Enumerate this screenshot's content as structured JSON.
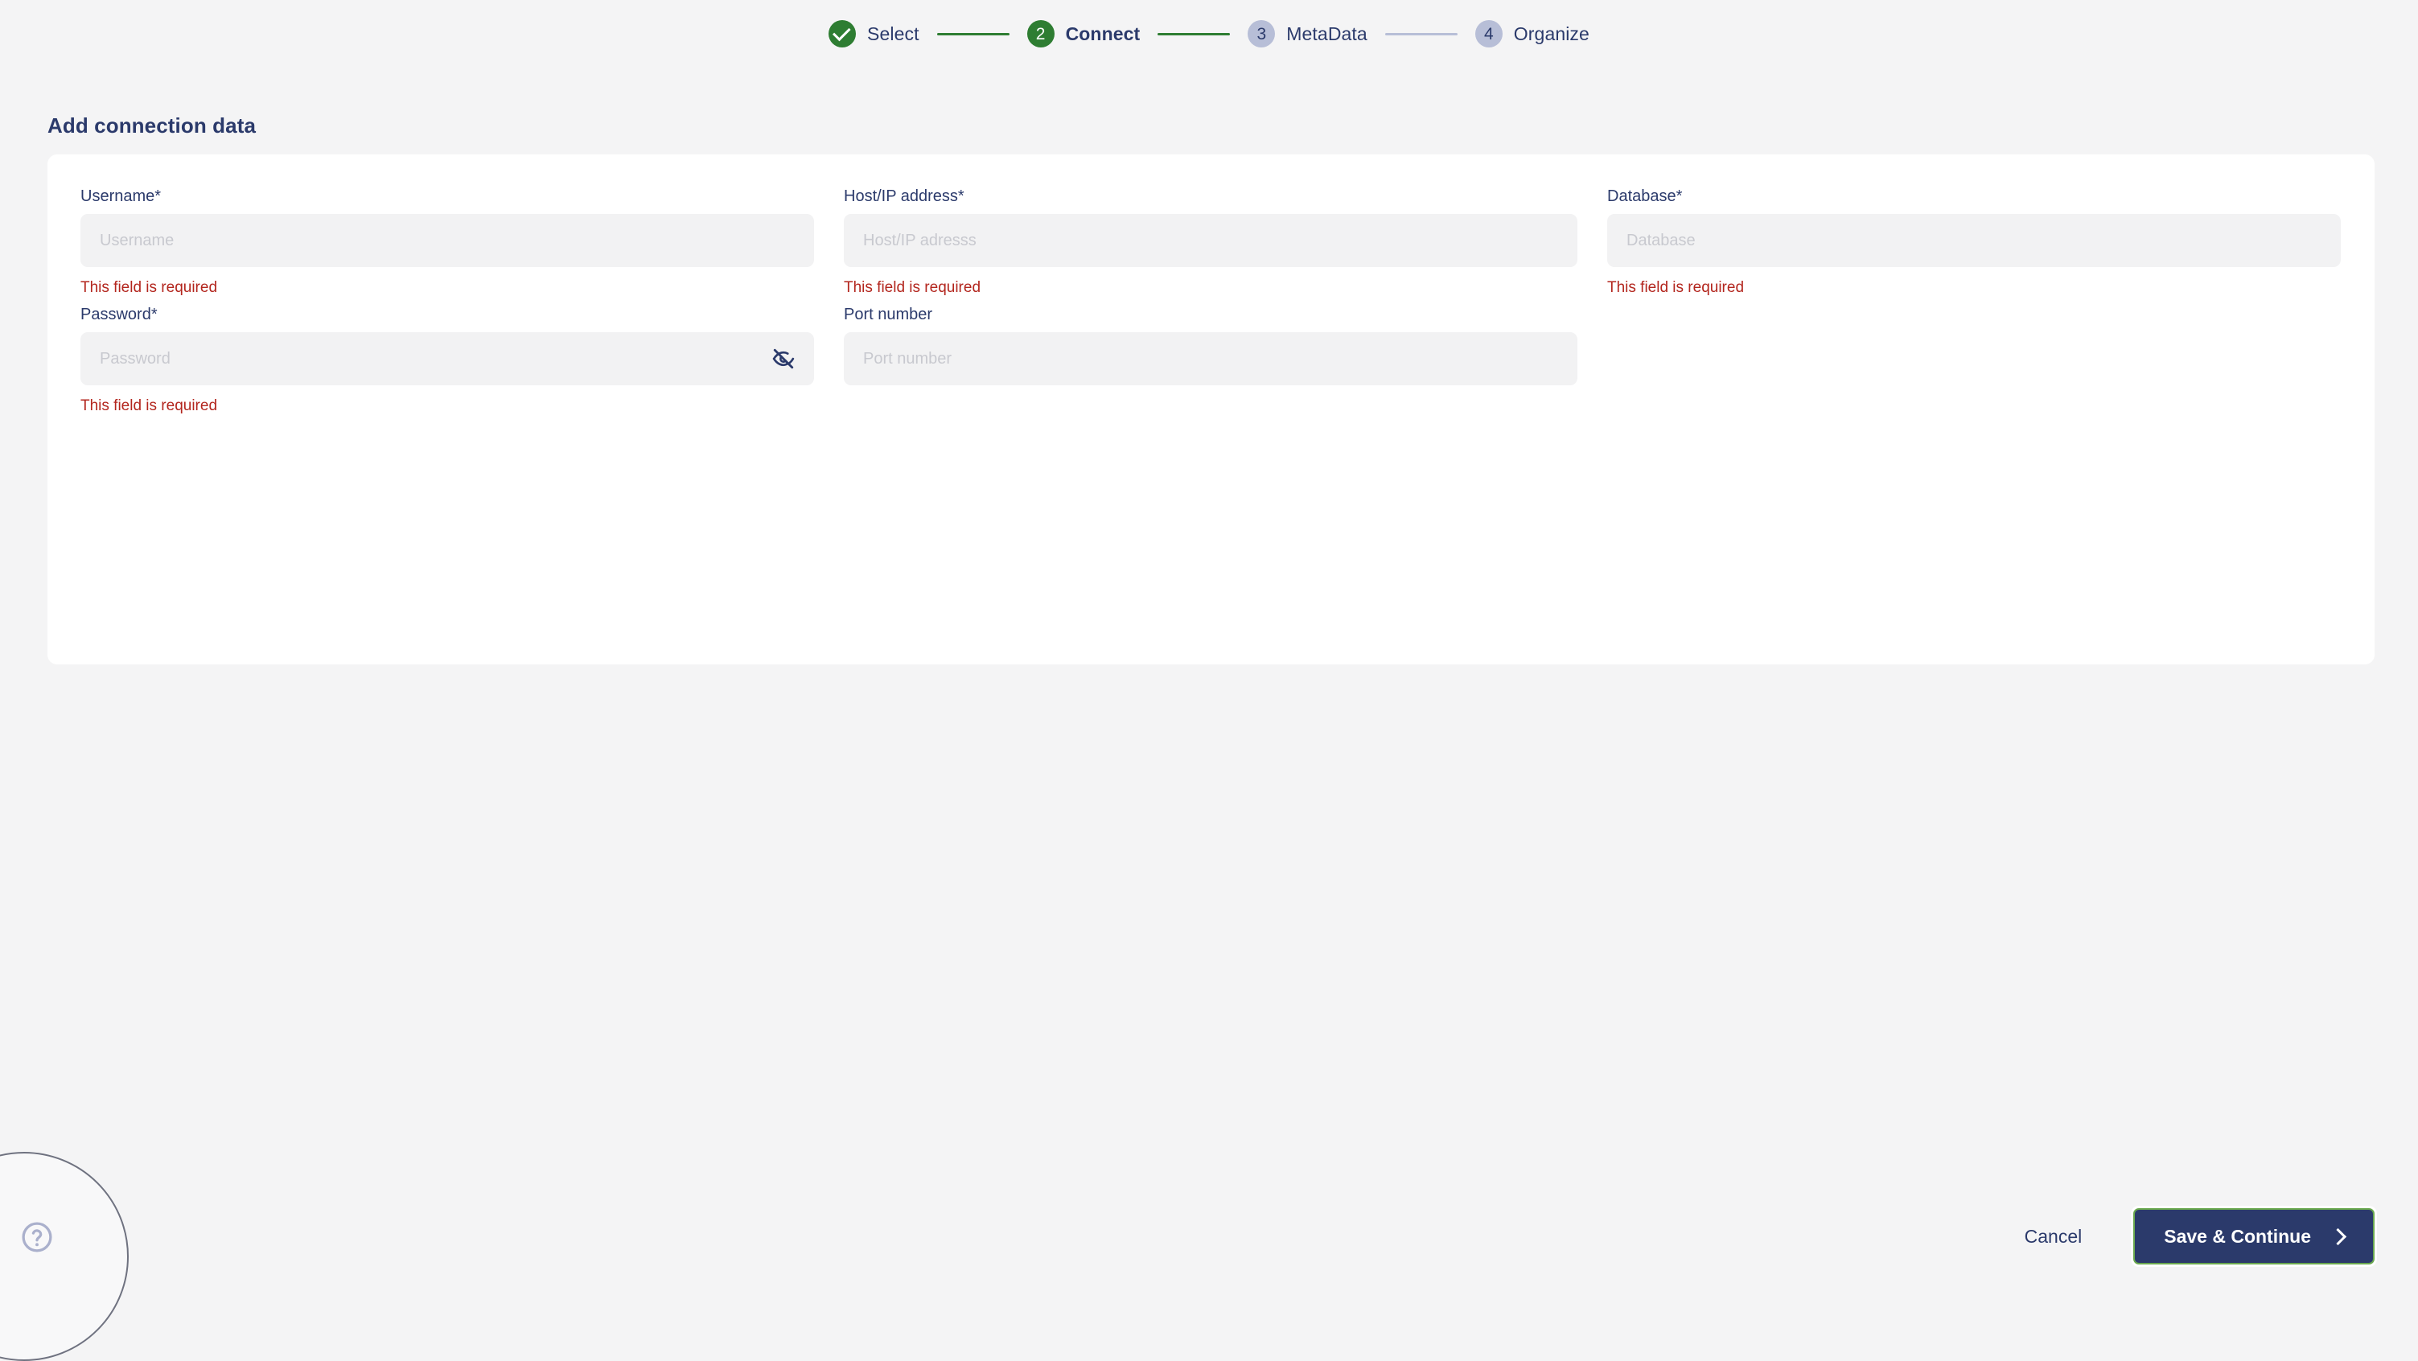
{
  "colors": {
    "page_background": "#f4f4f5",
    "card_background": "#ffffff",
    "navy": "#2b3a6b",
    "green": "#2e7d32",
    "grey_step": "#b7bed7",
    "error_red": "#b3261e",
    "input_background": "#f2f2f3",
    "placeholder": "#c8c9cf",
    "focus_ring_green": "#6aa84f"
  },
  "stepper": {
    "steps": [
      {
        "number": "1",
        "label": "Select",
        "state": "done",
        "icon": "check-icon"
      },
      {
        "number": "2",
        "label": "Connect",
        "state": "active",
        "icon": ""
      },
      {
        "number": "3",
        "label": "MetaData",
        "state": "todo",
        "icon": ""
      },
      {
        "number": "4",
        "label": "Organize",
        "state": "todo",
        "icon": ""
      }
    ],
    "connectors": [
      "green",
      "green",
      "grey"
    ]
  },
  "page": {
    "title": "Add connection data"
  },
  "form": {
    "columns": [
      {
        "fields": [
          {
            "label": "Username*",
            "placeholder": "Username",
            "value": "",
            "type": "text",
            "error": "This field is required",
            "icon": ""
          },
          {
            "label": "Password*",
            "placeholder": "Password",
            "value": "",
            "type": "password",
            "error": "This field is required",
            "icon": "eye-off-icon"
          }
        ]
      },
      {
        "fields": [
          {
            "label": "Host/IP address*",
            "placeholder": "Host/IP adresss",
            "value": "",
            "type": "text",
            "error": "This field is required",
            "icon": ""
          },
          {
            "label": "Port number",
            "placeholder": "Port number",
            "value": "",
            "type": "text",
            "error": "",
            "icon": ""
          }
        ]
      },
      {
        "fields": [
          {
            "label": "Database*",
            "placeholder": "Database",
            "value": "",
            "type": "text",
            "error": "This field is required",
            "icon": ""
          }
        ]
      }
    ]
  },
  "footer": {
    "cancel_label": "Cancel",
    "save_label": "Save & Continue",
    "save_icon": "chevron-right-icon"
  },
  "help": {
    "icon": "question-mark-circle-icon",
    "label": "?"
  }
}
